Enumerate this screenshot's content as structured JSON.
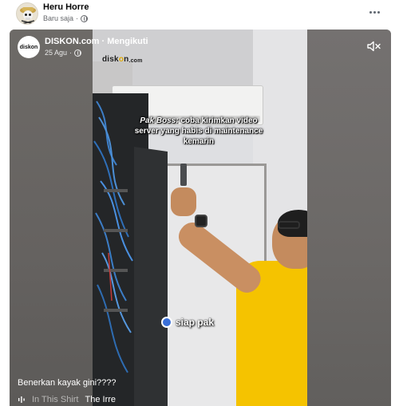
{
  "post": {
    "author": "Heru Horre",
    "time": "Baru saja",
    "more_icon": "more-horizontal-icon"
  },
  "reel": {
    "page_name": "DISKON.com · Mengikuti",
    "page_avatar_text": "diskon",
    "date": "25 Agu",
    "watermark_prefix": "disk",
    "watermark_o": "o",
    "watermark_suffix": "n",
    "watermark_sub": ".com",
    "overlay_speaker": "Pak Boss:",
    "overlay_text": "coba kirimkan video server yang habis di maintenance kemarin",
    "reply_text": "siap pak",
    "caption": "Benerkan kayak gini????",
    "music_track_1": "In This Shirt",
    "music_track_2": "The Irre",
    "mute_icon": "speaker-muted-icon",
    "music_icon": "audio-wave-icon"
  },
  "colors": {
    "shirt": "#f5c300",
    "brand_accent": "#e0a800"
  }
}
